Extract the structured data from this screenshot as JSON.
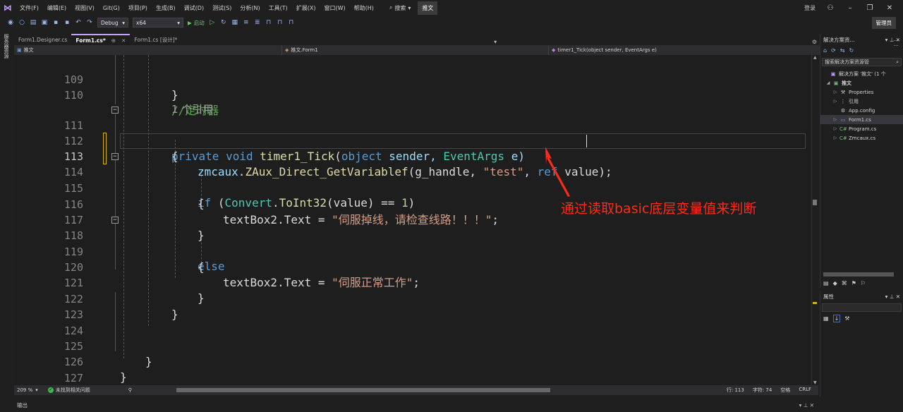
{
  "menu": {
    "items": [
      "文件(F)",
      "编辑(E)",
      "视图(V)",
      "Git(G)",
      "项目(P)",
      "生成(B)",
      "调试(D)",
      "测试(S)",
      "分析(N)",
      "工具(T)",
      "扩展(X)",
      "窗口(W)",
      "帮助(H)"
    ],
    "search_label": "搜索",
    "solution_name": "推文",
    "login": "登录",
    "manage_button": "管理员"
  },
  "toolbar": {
    "config": "Debug",
    "platform": "x64",
    "start_label": "启动"
  },
  "left_strip": {
    "label": "服务器资源"
  },
  "tabs": [
    {
      "label": "Form1.Designer.cs",
      "active": false
    },
    {
      "label": "Form1.cs*",
      "active": true
    },
    {
      "label": "Form1.cs [设计]*",
      "active": false
    }
  ],
  "navbar": {
    "project": "推文",
    "class": "推文.Form1",
    "member": "timer1_Tick(object sender, EventArgs e)"
  },
  "editor": {
    "line_numbers": [
      "109",
      "110",
      "",
      "111",
      "112",
      "113",
      "114",
      "115",
      "116",
      "117",
      "118",
      "119",
      "120",
      "121",
      "122",
      "123",
      "124",
      "125",
      "126",
      "127"
    ],
    "current_line": "113",
    "lines": {
      "l109": "}",
      "l110": "//定时器",
      "ref": "1 个引用",
      "l111_kw1": "private",
      "l111_kw2": "void",
      "l111_fn": "timer1_Tick",
      "l111_open": "(",
      "l111_kw3": "object",
      "l111_p1": " sender, ",
      "l111_ty": "EventArgs",
      "l111_p2": " e)",
      "l112": "{",
      "l113_obj": "zmcaux",
      "l113_dot": ".",
      "l113_fn": "ZAux_Direct_GetVariablef",
      "l113_a": "(g_handle, ",
      "l113_str": "\"test\"",
      "l113_b": ", ",
      "l113_ref": "ref",
      "l113_c": " value);",
      "l114_if": "if",
      "l114_a": " (",
      "l114_ty": "Convert",
      "l114_dot": ".",
      "l114_fn": "ToInt32",
      "l114_b": "(value) == ",
      "l114_num": "1",
      "l114_c": ")",
      "l115": "{",
      "l116_a": "textBox2.Text = ",
      "l116_str": "\"伺服掉线，请检查线路！！！\"",
      "l116_c": ";",
      "l117": "}",
      "l118": "else",
      "l119": "{",
      "l120_a": "textBox2.Text = ",
      "l120_str": "\"伺服正常工作\"",
      "l120_c": ";",
      "l121": "}",
      "l122": "}",
      "l125": "}",
      "l126": "}"
    }
  },
  "annotation": "通过读取basic底层变量值来判断",
  "status": {
    "zoom": "209 %",
    "issues": "未找到相关问题",
    "line": "行: 113",
    "char": "字符: 74",
    "whitespace": "空格",
    "eol": "CRLF"
  },
  "output": {
    "label": "输出"
  },
  "solution_explorer": {
    "title": "解决方案资...",
    "search_placeholder": "搜索解决方案资源管",
    "items": [
      {
        "label": "解决方案 '推文' (1 个",
        "indent": 0,
        "icon": "solution-icon",
        "twisty": ""
      },
      {
        "label": "推文",
        "indent": 1,
        "icon": "csproj-icon",
        "twisty": "◢"
      },
      {
        "label": "Properties",
        "indent": 2,
        "icon": "wrench-icon",
        "twisty": "▷"
      },
      {
        "label": "引用",
        "indent": 2,
        "icon": "references-icon",
        "twisty": "▷"
      },
      {
        "label": "App.config",
        "indent": 2,
        "icon": "config-icon",
        "twisty": ""
      },
      {
        "label": "Form1.cs",
        "indent": 2,
        "icon": "form-icon",
        "twisty": "▷",
        "selected": true
      },
      {
        "label": "Program.cs",
        "indent": 2,
        "icon": "csharp-icon",
        "twisty": "▷"
      },
      {
        "label": "Zmcaux.cs",
        "indent": 2,
        "icon": "csharp-icon",
        "twisty": "▷"
      }
    ]
  },
  "properties": {
    "title": "属性"
  },
  "colors": {
    "accent": "#c5a4ff",
    "annotation": "#ff2a1a",
    "keyword": "#569cd6",
    "type": "#4ec9b0",
    "string": "#d69d85",
    "comment": "#57a64a"
  }
}
